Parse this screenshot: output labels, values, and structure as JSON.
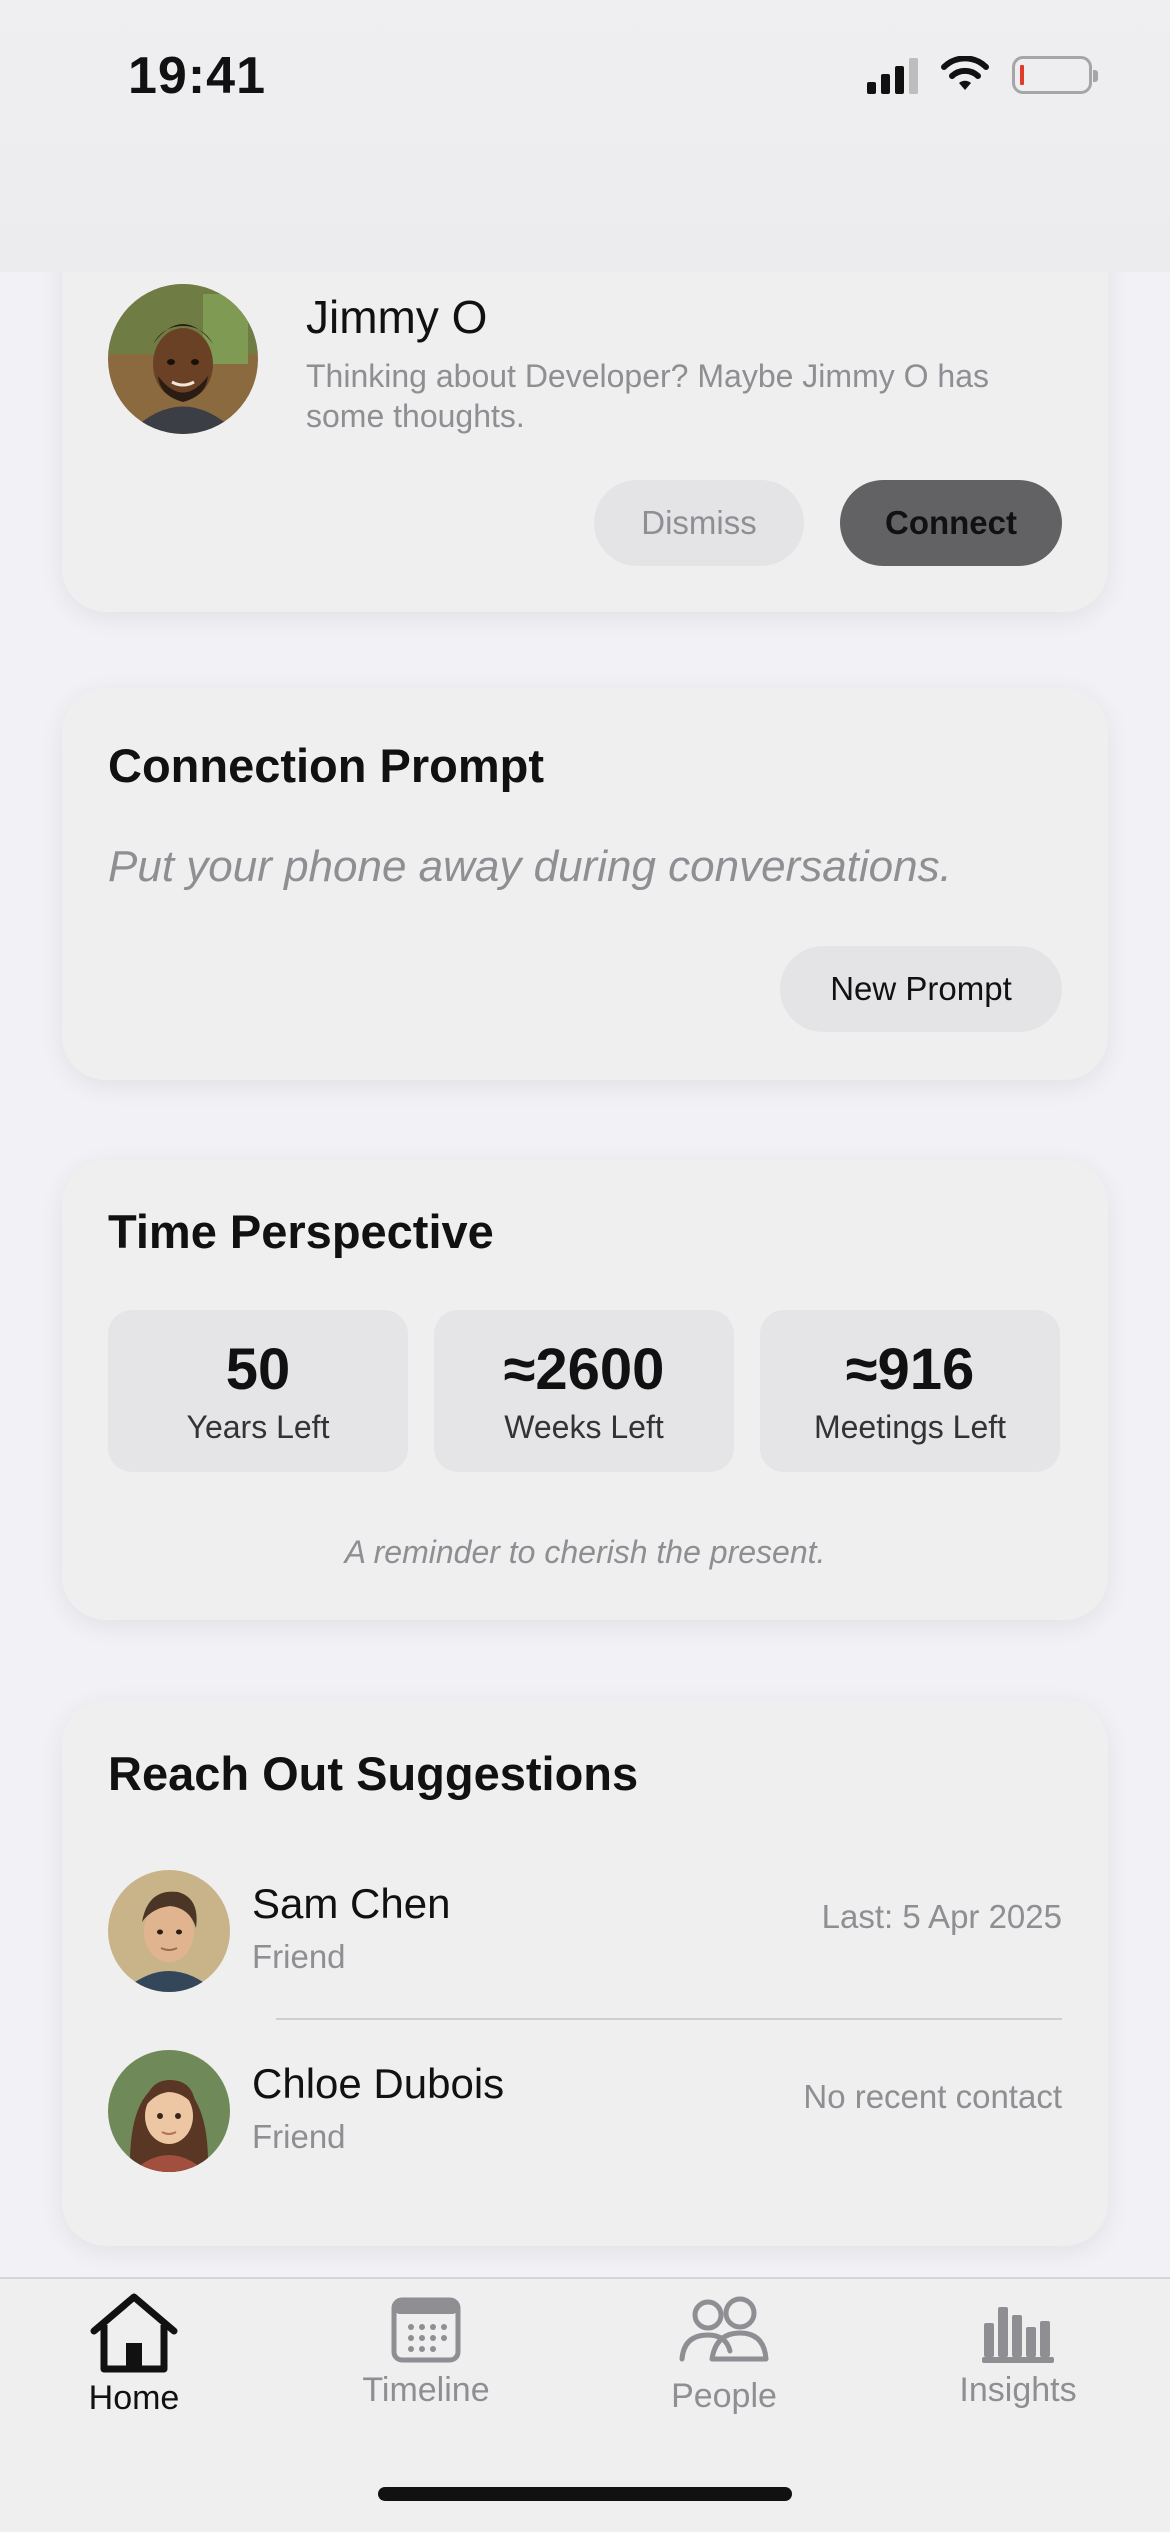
{
  "status_bar": {
    "time": "19:41"
  },
  "suggestion": {
    "name": "Jimmy O",
    "message": "Thinking about Developer? Maybe Jimmy O has some thoughts.",
    "dismiss_label": "Dismiss",
    "connect_label": "Connect"
  },
  "connection_prompt": {
    "title": "Connection Prompt",
    "text": "Put your phone away during conversations.",
    "button_label": "New Prompt"
  },
  "time_perspective": {
    "title": "Time Perspective",
    "stats": [
      {
        "value": "50",
        "label": "Years Left"
      },
      {
        "value": "≈2600",
        "label": "Weeks Left"
      },
      {
        "value": "≈916",
        "label": "Meetings Left"
      }
    ],
    "footnote": "A reminder to cherish the present."
  },
  "reach_out": {
    "title": "Reach Out Suggestions",
    "people": [
      {
        "name": "Sam Chen",
        "relation": "Friend",
        "meta": "Last: 5 Apr 2025"
      },
      {
        "name": "Chloe Dubois",
        "relation": "Friend",
        "meta": "No recent contact"
      }
    ]
  },
  "tab_bar": {
    "tabs": [
      {
        "label": "Home",
        "icon": "house-icon",
        "active": true
      },
      {
        "label": "Timeline",
        "icon": "calendar-icon",
        "active": false
      },
      {
        "label": "People",
        "icon": "people-icon",
        "active": false
      },
      {
        "label": "Insights",
        "icon": "bar-chart-icon",
        "active": false
      }
    ]
  },
  "colors": {
    "accent_dark": "#626264",
    "background": "#f2f2f6",
    "card": "#efeff0",
    "muted_text": "#8e8e93"
  }
}
